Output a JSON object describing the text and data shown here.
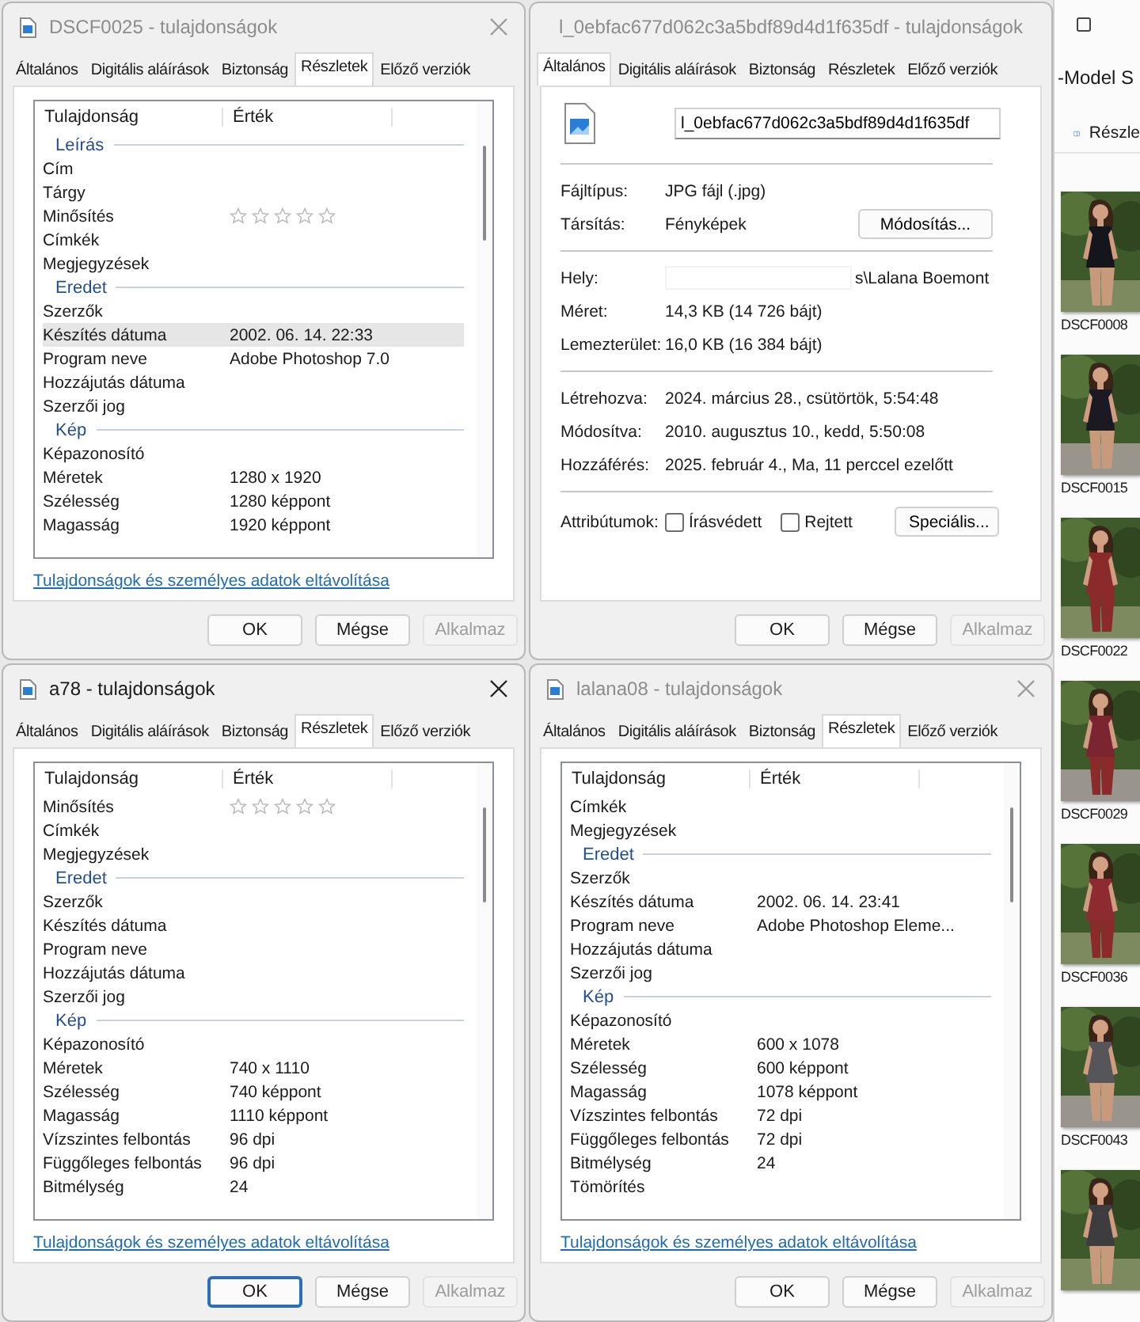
{
  "windows": [
    {
      "kind": "details",
      "title": "DSCF0025 - tulajdonságok",
      "active": false,
      "tabs": [
        {
          "label": "Általános",
          "selected": false
        },
        {
          "label": "Digitális aláírások",
          "selected": false
        },
        {
          "label": "Biztonság",
          "selected": false
        },
        {
          "label": "Részletek",
          "selected": true
        },
        {
          "label": "Előző verziók",
          "selected": false
        }
      ],
      "columns": [
        "Tulajdonság",
        "Érték"
      ],
      "rows": [
        {
          "kind": "group",
          "name": "Leírás",
          "selected": false
        },
        {
          "kind": "prop",
          "name": "Cím",
          "selected": false
        },
        {
          "kind": "prop",
          "name": "Tárgy",
          "selected": false
        },
        {
          "kind": "stars",
          "name": "Minősítés",
          "stars": 0,
          "selected": false
        },
        {
          "kind": "prop",
          "name": "Címkék",
          "selected": false
        },
        {
          "kind": "prop",
          "name": "Megjegyzések",
          "selected": false
        },
        {
          "kind": "group",
          "name": "Eredet",
          "selected": false
        },
        {
          "kind": "prop",
          "name": "Szerzők",
          "selected": false
        },
        {
          "kind": "prop",
          "name": "Készítés dátuma",
          "value": "2002. 06. 14. 22:33",
          "selected": true
        },
        {
          "kind": "prop",
          "name": "Program neve",
          "value": "Adobe Photoshop 7.0",
          "selected": false
        },
        {
          "kind": "prop",
          "name": "Hozzájutás dátuma",
          "selected": false
        },
        {
          "kind": "prop",
          "name": "Szerzői jog",
          "selected": false
        },
        {
          "kind": "group",
          "name": "Kép",
          "selected": false
        },
        {
          "kind": "prop",
          "name": "Képazonosító",
          "selected": false
        },
        {
          "kind": "prop",
          "name": "Méretek",
          "value": "1280 x 1920",
          "selected": false
        },
        {
          "kind": "prop",
          "name": "Szélesség",
          "value": "1280 képpont",
          "selected": false
        },
        {
          "kind": "prop",
          "name": "Magasság",
          "value": "1920 képpont",
          "selected": false
        }
      ],
      "link": "Tulajdonságok és személyes adatok eltávolítása",
      "buttons": [
        {
          "label": "OK",
          "focused": false,
          "disabled": false
        },
        {
          "label": "Mégse",
          "focused": false,
          "disabled": false
        },
        {
          "label": "Alkalmaz",
          "focused": false,
          "disabled": true
        }
      ]
    },
    {
      "kind": "general",
      "title": "l_0ebfac677d062c3a5bdf89d4d1f635df - tulajdonságok",
      "active": false,
      "tabs": [
        {
          "label": "Általános",
          "selected": true
        },
        {
          "label": "Digitális aláírások",
          "selected": false
        },
        {
          "label": "Biztonság",
          "selected": false
        },
        {
          "label": "Részletek",
          "selected": false
        },
        {
          "label": "Előző verziók",
          "selected": false
        }
      ],
      "file_name": "l_0ebfac677d062c3a5bdf89d4d1f635df",
      "sections": [
        [
          {
            "kind": "text",
            "label": "Fájltípus:",
            "value": "JPG fájl (.jpg)"
          },
          {
            "kind": "button",
            "label": "Társítás:",
            "value": "Fényképek",
            "button": "Módosítás..."
          }
        ],
        [
          {
            "kind": "masked",
            "label": "Hely:",
            "value": "s\\Lalana Boemont"
          },
          {
            "kind": "text",
            "label": "Méret:",
            "value": "14,3 KB (14 726 bájt)"
          },
          {
            "kind": "text",
            "label": "Lemezterület:",
            "value": "16,0 KB (16 384 bájt)"
          }
        ],
        [
          {
            "kind": "text",
            "label": "Létrehozva:",
            "value": "2024. március 28., csütörtök, 5:54:48"
          },
          {
            "kind": "text",
            "label": "Módosítva:",
            "value": "2010. augusztus 10., kedd, 5:50:08"
          },
          {
            "kind": "text",
            "label": "Hozzáférés:",
            "value": "2025. február 4., Ma, 11 perccel ezelőtt"
          }
        ]
      ],
      "attributes": {
        "label": "Attribútumok:",
        "checks": [
          {
            "label": "Írásvédett",
            "checked": false
          },
          {
            "label": "Rejtett",
            "checked": false
          }
        ],
        "button": "Speciális..."
      },
      "buttons": [
        {
          "label": "OK",
          "focused": false,
          "disabled": false
        },
        {
          "label": "Mégse",
          "focused": false,
          "disabled": false
        },
        {
          "label": "Alkalmaz",
          "focused": false,
          "disabled": true
        }
      ]
    },
    {
      "kind": "details",
      "title": "a78 - tulajdonságok",
      "active": true,
      "tabs": [
        {
          "label": "Általános",
          "selected": false
        },
        {
          "label": "Digitális aláírások",
          "selected": false
        },
        {
          "label": "Biztonság",
          "selected": false
        },
        {
          "label": "Részletek",
          "selected": true
        },
        {
          "label": "Előző verziók",
          "selected": false
        }
      ],
      "columns": [
        "Tulajdonság",
        "Érték"
      ],
      "rows": [
        {
          "kind": "stars",
          "name": "Minősítés",
          "stars": 0,
          "selected": false
        },
        {
          "kind": "prop",
          "name": "Címkék",
          "selected": false
        },
        {
          "kind": "prop",
          "name": "Megjegyzések",
          "selected": false
        },
        {
          "kind": "group",
          "name": "Eredet",
          "selected": false
        },
        {
          "kind": "prop",
          "name": "Szerzők",
          "selected": false
        },
        {
          "kind": "prop",
          "name": "Készítés dátuma",
          "selected": false
        },
        {
          "kind": "prop",
          "name": "Program neve",
          "selected": false
        },
        {
          "kind": "prop",
          "name": "Hozzájutás dátuma",
          "selected": false
        },
        {
          "kind": "prop",
          "name": "Szerzői jog",
          "selected": false
        },
        {
          "kind": "group",
          "name": "Kép",
          "selected": false
        },
        {
          "kind": "prop",
          "name": "Képazonosító",
          "selected": false
        },
        {
          "kind": "prop",
          "name": "Méretek",
          "value": "740 x 1110",
          "selected": false
        },
        {
          "kind": "prop",
          "name": "Szélesség",
          "value": "740 képpont",
          "selected": false
        },
        {
          "kind": "prop",
          "name": "Magasság",
          "value": "1110 képpont",
          "selected": false
        },
        {
          "kind": "prop",
          "name": "Vízszintes felbontás",
          "value": "96 dpi",
          "selected": false
        },
        {
          "kind": "prop",
          "name": "Függőleges felbontás",
          "value": "96 dpi",
          "selected": false
        },
        {
          "kind": "prop",
          "name": "Bitmélység",
          "value": "24",
          "selected": false
        }
      ],
      "link": "Tulajdonságok és személyes adatok eltávolítása",
      "buttons": [
        {
          "label": "OK",
          "focused": true,
          "disabled": false
        },
        {
          "label": "Mégse",
          "focused": false,
          "disabled": false
        },
        {
          "label": "Alkalmaz",
          "focused": false,
          "disabled": true
        }
      ]
    },
    {
      "kind": "details",
      "title": "lalana08 - tulajdonságok",
      "active": false,
      "tabs": [
        {
          "label": "Általános",
          "selected": false
        },
        {
          "label": "Digitális aláírások",
          "selected": false
        },
        {
          "label": "Biztonság",
          "selected": false
        },
        {
          "label": "Részletek",
          "selected": true
        },
        {
          "label": "Előző verziók",
          "selected": false
        }
      ],
      "columns": [
        "Tulajdonság",
        "Érték"
      ],
      "rows": [
        {
          "kind": "prop",
          "name": "Címkék",
          "selected": false
        },
        {
          "kind": "prop",
          "name": "Megjegyzések",
          "selected": false
        },
        {
          "kind": "group",
          "name": "Eredet",
          "selected": false
        },
        {
          "kind": "prop",
          "name": "Szerzők",
          "selected": false
        },
        {
          "kind": "prop",
          "name": "Készítés dátuma",
          "value": "2002. 06. 14. 23:41",
          "selected": false
        },
        {
          "kind": "prop",
          "name": "Program neve",
          "value": "Adobe Photoshop Eleme...",
          "selected": false
        },
        {
          "kind": "prop",
          "name": "Hozzájutás dátuma",
          "selected": false
        },
        {
          "kind": "prop",
          "name": "Szerzői jog",
          "selected": false
        },
        {
          "kind": "group",
          "name": "Kép",
          "selected": false
        },
        {
          "kind": "prop",
          "name": "Képazonosító",
          "selected": false
        },
        {
          "kind": "prop",
          "name": "Méretek",
          "value": "600 x 1078",
          "selected": false
        },
        {
          "kind": "prop",
          "name": "Szélesség",
          "value": "600 képpont",
          "selected": false
        },
        {
          "kind": "prop",
          "name": "Magasság",
          "value": "1078 képpont",
          "selected": false
        },
        {
          "kind": "prop",
          "name": "Vízszintes felbontás",
          "value": "72 dpi",
          "selected": false
        },
        {
          "kind": "prop",
          "name": "Függőleges felbontás",
          "value": "72 dpi",
          "selected": false
        },
        {
          "kind": "prop",
          "name": "Bitmélység",
          "value": "24",
          "selected": false
        },
        {
          "kind": "prop",
          "name": "Tömörítés",
          "selected": false
        }
      ],
      "link": "Tulajdonságok és személyes adatok eltávolítása",
      "buttons": [
        {
          "label": "OK",
          "focused": false,
          "disabled": false
        },
        {
          "label": "Mégse",
          "focused": false,
          "disabled": false
        },
        {
          "label": "Alkalmaz",
          "focused": false,
          "disabled": true
        }
      ]
    }
  ],
  "explorer": {
    "heading": "-Model S",
    "toolbar_button": "Részle",
    "thumbnails": [
      {
        "kind": "picture",
        "label": "DSCF0008"
      },
      {
        "kind": "picture",
        "label": "DSCF0015"
      },
      {
        "kind": "picture",
        "label": "DSCF0022"
      },
      {
        "kind": "picture",
        "label": "DSCF0029"
      },
      {
        "kind": "picture",
        "label": "DSCF0036"
      },
      {
        "kind": "picture",
        "label": "DSCF0043"
      },
      {
        "kind": "picture"
      }
    ]
  }
}
